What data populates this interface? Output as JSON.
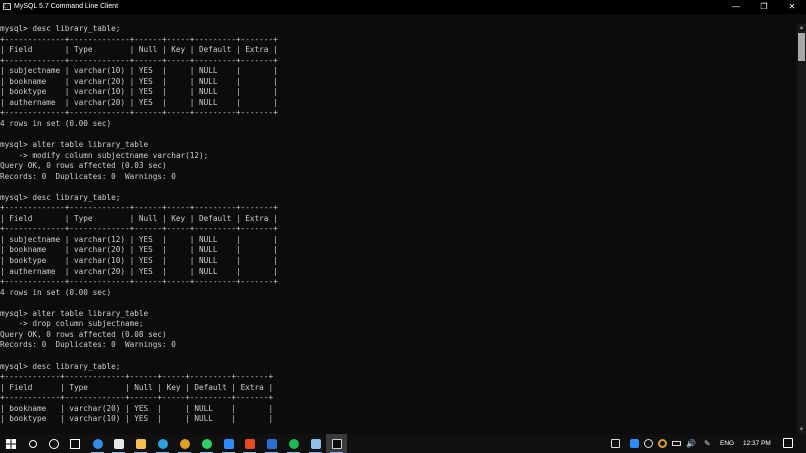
{
  "window": {
    "title": "MySQL 5.7 Command Line Client",
    "minimize": "—",
    "maximize": "❐",
    "close": "✕"
  },
  "terminal": {
    "lines": [
      "mysql> desc library_table;",
      "+-------------+-------------+------+-----+---------+-------+",
      "| Field       | Type        | Null | Key | Default | Extra |",
      "+-------------+-------------+------+-----+---------+-------+",
      "| subjectname | varchar(10) | YES  |     | NULL    |       |",
      "| bookname    | varchar(20) | YES  |     | NULL    |       |",
      "| booktype    | varchar(10) | YES  |     | NULL    |       |",
      "| authername  | varchar(20) | YES  |     | NULL    |       |",
      "+-------------+-------------+------+-----+---------+-------+",
      "4 rows in set (0.00 sec)",
      "",
      "mysql> alter table library_table",
      "    -> modify column subjectname varchar(12);",
      "Query OK, 0 rows affected (0.03 sec)",
      "Records: 0  Duplicates: 0  Warnings: 0",
      "",
      "mysql> desc library_table;",
      "+-------------+-------------+------+-----+---------+-------+",
      "| Field       | Type        | Null | Key | Default | Extra |",
      "+-------------+-------------+------+-----+---------+-------+",
      "| subjectname | varchar(12) | YES  |     | NULL    |       |",
      "| bookname    | varchar(20) | YES  |     | NULL    |       |",
      "| booktype    | varchar(10) | YES  |     | NULL    |       |",
      "| authername  | varchar(20) | YES  |     | NULL    |       |",
      "+-------------+-------------+------+-----+---------+-------+",
      "4 rows in set (0.00 sec)",
      "",
      "mysql> alter table library_table",
      "    -> drop column subjectname;",
      "Query OK, 0 rows affected (0.08 sec)",
      "Records: 0  Duplicates: 0  Warnings: 0",
      "",
      "mysql> desc library_table;",
      "+------------+-------------+------+-----+---------+-------+",
      "| Field      | Type        | Null | Key | Default | Extra |",
      "+------------+-------------+------+-----+---------+-------+",
      "| bookname   | varchar(20) | YES  |     | NULL    |       |",
      "| booktype   | varchar(10) | YES  |     | NULL    |       |"
    ]
  },
  "taskbar": {
    "apps": [
      {
        "name": "windows-start-icon",
        "color": "#ffffff"
      },
      {
        "name": "search-icon",
        "color": "#ffffff"
      },
      {
        "name": "cortana-circle-icon",
        "color": "#ffffff"
      },
      {
        "name": "task-view-icon",
        "color": "#ffffff"
      },
      {
        "name": "edge-browser-icon",
        "color": "#2f8fe8"
      },
      {
        "name": "store-bag-icon",
        "color": "#e6e6e6"
      },
      {
        "name": "file-explorer-folder-icon",
        "color": "#f2c14e"
      },
      {
        "name": "telegram-icon",
        "color": "#2aa3e0"
      },
      {
        "name": "chrome-icon",
        "color": "#e0a020"
      },
      {
        "name": "whatsapp-icon",
        "color": "#25d366"
      },
      {
        "name": "zoom-icon",
        "color": "#2d8cff"
      },
      {
        "name": "office-icon",
        "color": "#e8491d"
      },
      {
        "name": "document-icon",
        "color": "#2b6fd6"
      },
      {
        "name": "spotify-icon",
        "color": "#1db954"
      },
      {
        "name": "notepad-icon",
        "color": "#8fc0e8"
      },
      {
        "name": "mysql-terminal-icon",
        "color": "#cccccc"
      }
    ],
    "tray": {
      "language": "ENG",
      "time": "12:37 PM"
    }
  }
}
